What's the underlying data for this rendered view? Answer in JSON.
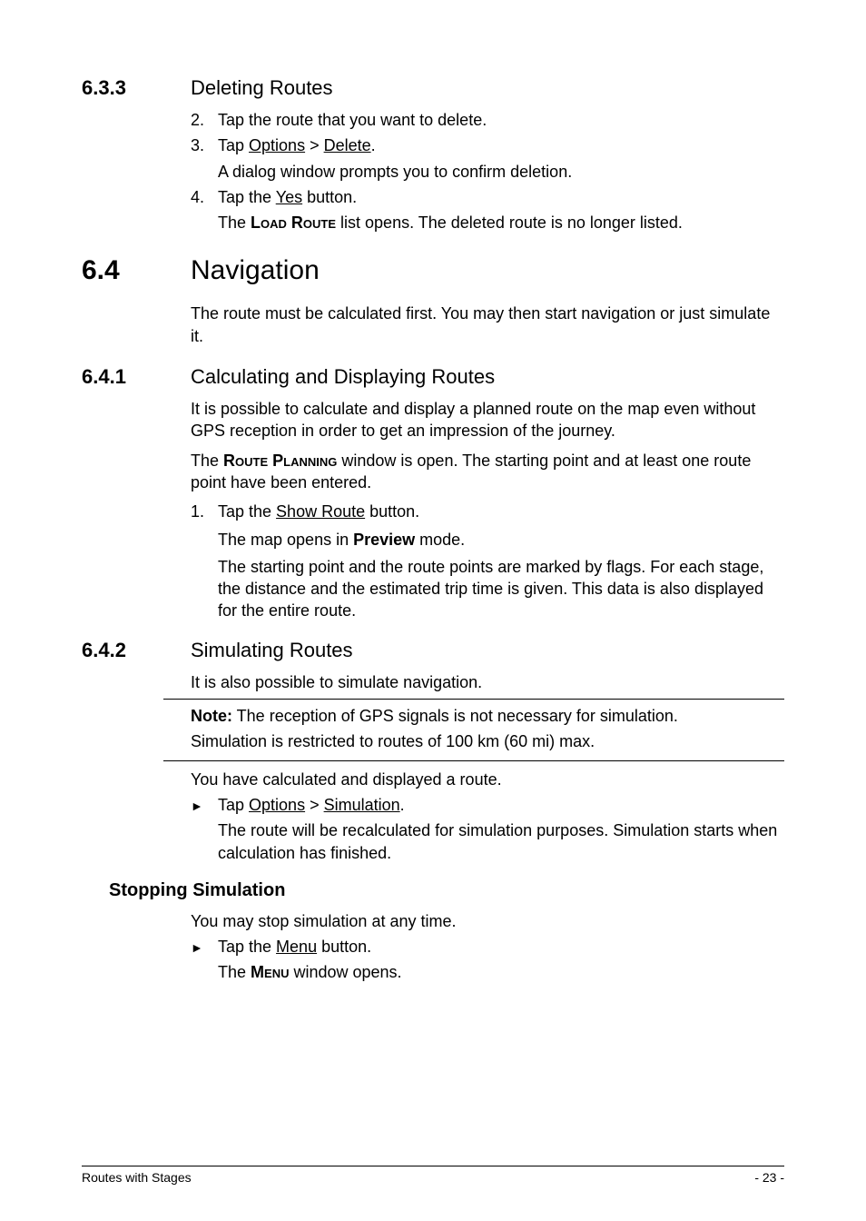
{
  "s633": {
    "num": "6.3.3",
    "title": "Deleting Routes",
    "steps": [
      {
        "n": "2.",
        "t": "Tap the route that you want to delete."
      },
      {
        "n": "3.",
        "t_pre": "Tap ",
        "u1": "Options",
        "mid": " > ",
        "u2": "Delete",
        "post": ".",
        "sub": "A dialog window prompts you to confirm deletion."
      },
      {
        "n": "4.",
        "t_pre": "Tap the ",
        "u1": "Yes",
        "post": " button.",
        "sub_pre": "The ",
        "sub_b": "Load Route",
        "sub_post": " list opens. The deleted route is no longer listed."
      }
    ]
  },
  "s64": {
    "num": "6.4",
    "title": "Navigation",
    "intro": "The route must be calculated first. You may then start navigation or just simulate it."
  },
  "s641": {
    "num": "6.4.1",
    "title": "Calculating and Displaying Routes",
    "p1": "It is possible to calculate and display a planned route on the map even without GPS reception in order to get an impression of the journey.",
    "p2_pre": "The ",
    "p2_b": "Route Planning",
    "p2_post": " window is open. The starting point and at least one route point have been entered.",
    "step_n": "1.",
    "step_pre": "Tap the ",
    "step_u": "Show Route",
    "step_post": " button.",
    "sub1_pre": "The map opens in ",
    "sub1_b": "Preview",
    "sub1_post": " mode.",
    "sub2": "The starting point and the route points are marked by flags. For each stage, the distance and the estimated trip time is given. This data is also displayed for the entire route."
  },
  "s642": {
    "num": "6.4.2",
    "title": "Simulating Routes",
    "p1": "It is also possible to simulate navigation.",
    "note_pre": "Note:",
    "note1": " The reception of GPS signals is not necessary for simulation.",
    "note2": "Simulation is restricted to routes of 100 km (60 mi) max.",
    "p2": "You have calculated and displayed a route.",
    "b_pre": "Tap ",
    "b_u1": "Options",
    "b_mid": " > ",
    "b_u2": "Simulation",
    "b_post": ".",
    "b_sub": "The route will be recalculated for simulation purposes. Simulation starts when calculation has finished."
  },
  "stopping": {
    "title": "Stopping Simulation",
    "p1": "You may stop simulation at any time.",
    "b_pre": "Tap the ",
    "b_u": "Menu",
    "b_post": " button.",
    "sub_pre": "The ",
    "sub_b": "Menu",
    "sub_post": " window opens."
  },
  "footer": {
    "left": "Routes with Stages",
    "right": "- 23 -"
  }
}
